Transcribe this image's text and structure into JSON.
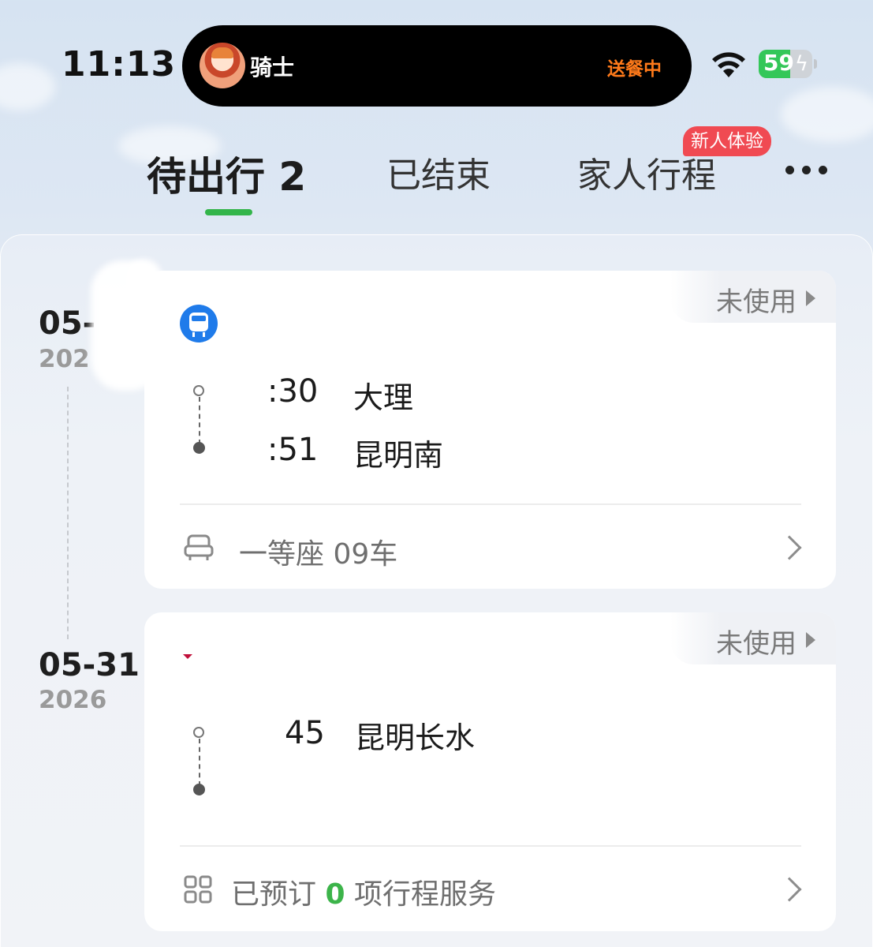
{
  "status_bar": {
    "time": "11:13",
    "live_activity": {
      "rider_label": "骑士",
      "status": "送餐中"
    },
    "battery_percent": 59
  },
  "tabs": [
    {
      "label": "待出行 2",
      "active": true
    },
    {
      "label": "已结束",
      "active": false
    },
    {
      "label": "家人行程",
      "active": false,
      "badge": "新人体验"
    }
  ],
  "trips": [
    {
      "date": "05-",
      "year": "202",
      "status": "未使用",
      "departure": {
        "time": ":30",
        "station": "大理"
      },
      "arrival": {
        "time": ":51",
        "station": "昆明南"
      },
      "footer": {
        "text": "一等座 09车 "
      }
    },
    {
      "date": "05-31",
      "year": "2026",
      "status": "未使用",
      "departure": {
        "time": "45",
        "station": "昆明长水"
      },
      "footer": {
        "prefix": "已预订",
        "count": "0",
        "suffix": "项行程服务"
      }
    }
  ],
  "colors": {
    "accent_green": "#33b54a",
    "badge_red": "#f04a52",
    "train_blue": "#1f7bea",
    "island_status_orange": "#ff7a1a"
  }
}
